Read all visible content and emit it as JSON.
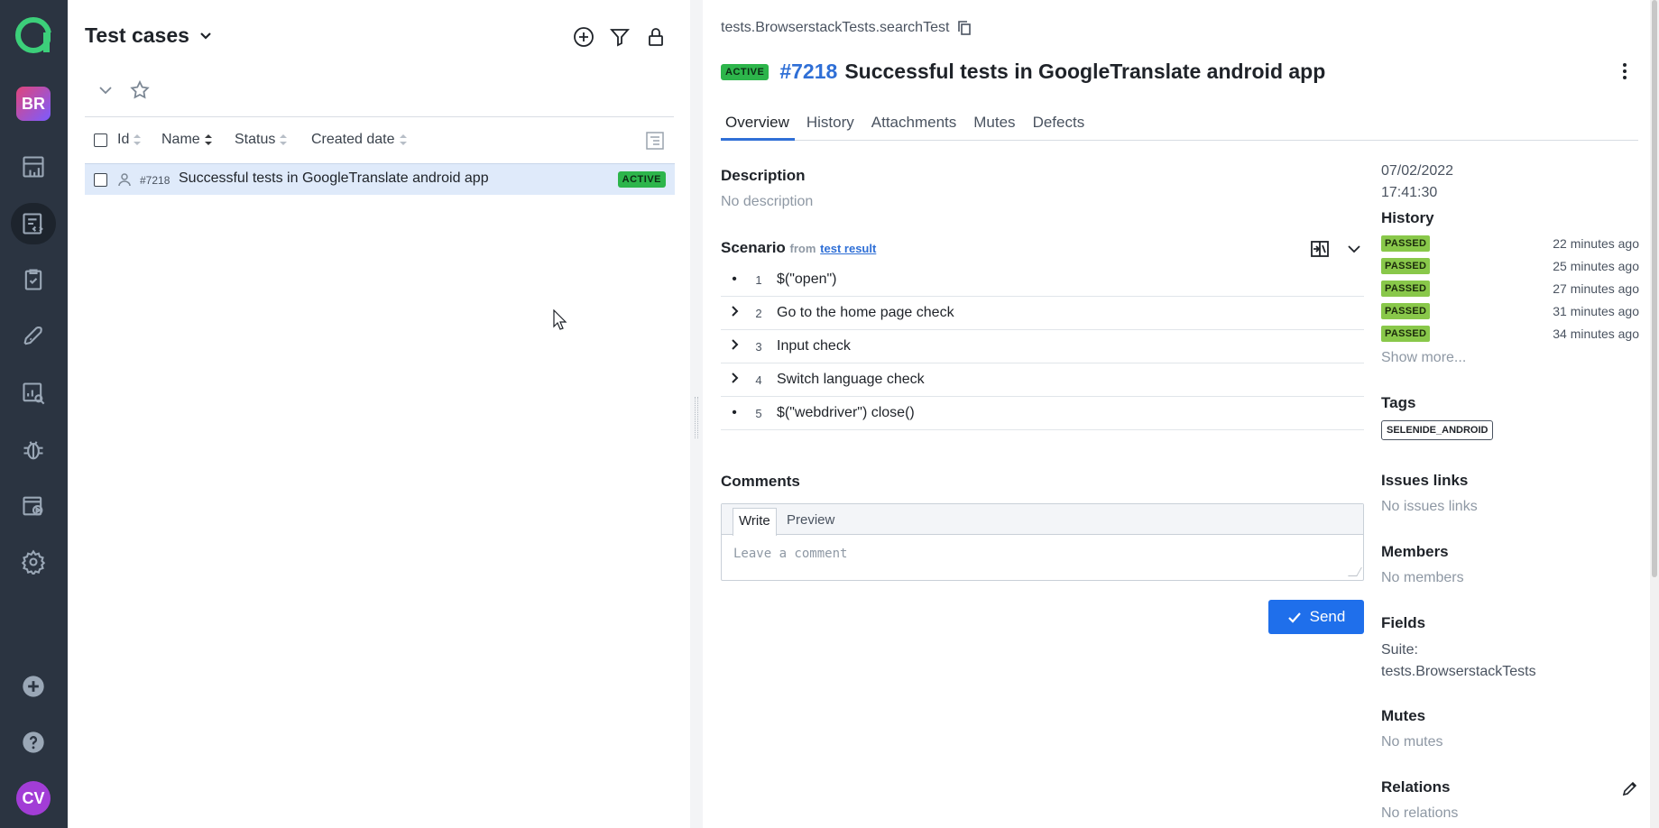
{
  "sidebar": {
    "avatar_top": "BR",
    "avatar_bottom": "CV",
    "items": [
      "dashboard-icon",
      "test-cases-icon",
      "test-plans-icon",
      "launches-icon",
      "analytics-icon",
      "defects-icon",
      "jobs-icon",
      "settings-icon"
    ],
    "bottom_items": [
      "add-icon",
      "help-icon"
    ],
    "background": "#2b3441"
  },
  "left_panel": {
    "title": "Test cases",
    "columns": [
      "Id",
      "Name",
      "Status",
      "Created date"
    ],
    "rows": [
      {
        "id": "#7218",
        "name": "Successful tests in GoogleTranslate android app",
        "status": "ACTIVE"
      }
    ]
  },
  "detail": {
    "breadcrumb": "tests.BrowserstackTests.searchTest",
    "status": "ACTIVE",
    "id": "#7218",
    "title": "Successful tests in GoogleTranslate android app",
    "tabs": [
      "Overview",
      "History",
      "Attachments",
      "Mutes",
      "Defects"
    ],
    "description_label": "Description",
    "description_value": "No description",
    "scenario_label": "Scenario",
    "scenario_from": "from",
    "scenario_link": "test result",
    "steps": [
      {
        "lead": "•",
        "num": "1",
        "text": "$(\"open\")"
      },
      {
        "lead": "chevron",
        "num": "2",
        "text": "Go to the home page check"
      },
      {
        "lead": "chevron",
        "num": "3",
        "text": "Input check"
      },
      {
        "lead": "chevron",
        "num": "4",
        "text": "Switch language check"
      },
      {
        "lead": "•",
        "num": "5",
        "text": "$(\"webdriver\") close()"
      }
    ],
    "comments_label": "Comments",
    "comment_tab_write": "Write",
    "comment_tab_preview": "Preview",
    "comment_placeholder": "Leave a comment",
    "send_label": "Send"
  },
  "side": {
    "date": "07/02/2022",
    "time": "17:41:30",
    "history_label": "History",
    "history": [
      {
        "status": "PASSED",
        "time": "22 minutes ago"
      },
      {
        "status": "PASSED",
        "time": "25 minutes ago"
      },
      {
        "status": "PASSED",
        "time": "27 minutes ago"
      },
      {
        "status": "PASSED",
        "time": "31 minutes ago"
      },
      {
        "status": "PASSED",
        "time": "34 minutes ago"
      }
    ],
    "show_more": "Show more...",
    "tags_label": "Tags",
    "tag": "SELENIDE_ANDROID",
    "issues_label": "Issues links",
    "issues_value": "No issues links",
    "members_label": "Members",
    "members_value": "No members",
    "fields_label": "Fields",
    "fields_suite_key": "Suite:",
    "fields_suite_value": "tests.BrowserstackTests",
    "mutes_label": "Mutes",
    "mutes_value": "No mutes",
    "relations_label": "Relations",
    "relations_value": "No relations"
  },
  "colors": {
    "accent": "#1f6feb",
    "active_badge": "#2db54b",
    "passed_badge": "#89c84a",
    "selected_row": "#dfeafa"
  }
}
